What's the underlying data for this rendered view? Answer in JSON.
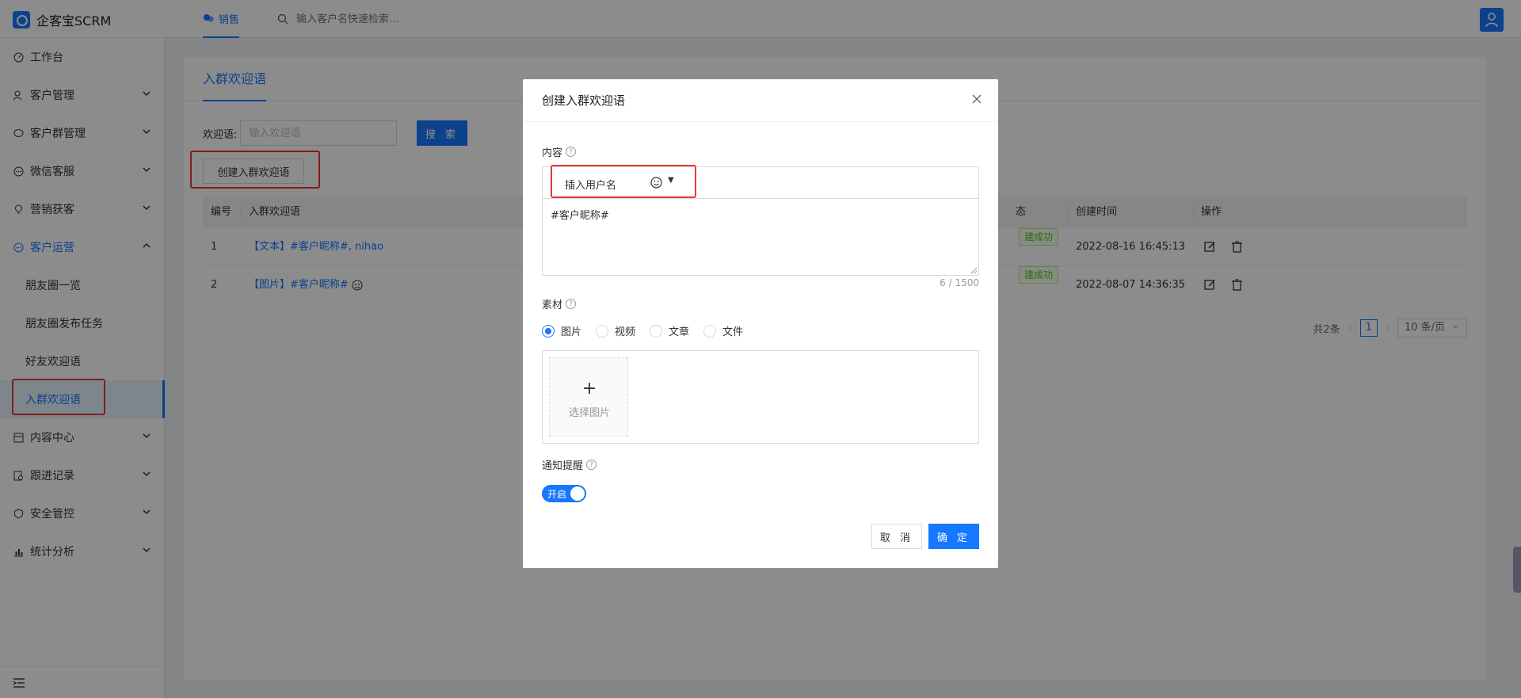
{
  "header": {
    "app_name": "企客宝SCRM",
    "tab_label": "销售",
    "search_placeholder": "输入客户名快速检索..."
  },
  "sidebar": {
    "items": [
      {
        "label": "工作台",
        "icon": "dashboard-icon"
      },
      {
        "label": "客户管理",
        "icon": "user-icon"
      },
      {
        "label": "客户群管理",
        "icon": "chat-group-icon"
      },
      {
        "label": "微信客服",
        "icon": "service-icon"
      },
      {
        "label": "营销获客",
        "icon": "bulb-icon"
      },
      {
        "label": "客户运营",
        "icon": "operation-icon"
      },
      {
        "label": "内容中心",
        "icon": "content-icon"
      },
      {
        "label": "跟进记录",
        "icon": "record-icon"
      },
      {
        "label": "安全管控",
        "icon": "shield-icon"
      },
      {
        "label": "统计分析",
        "icon": "chart-icon"
      }
    ],
    "sub_items": [
      "朋友圈一览",
      "朋友圈发布任务",
      "好友欢迎语",
      "入群欢迎语"
    ]
  },
  "main": {
    "tab": "入群欢迎语",
    "filter_label": "欢迎语:",
    "filter_placeholder": "输入欢迎语",
    "search_button": "搜 索",
    "create_button": "创建入群欢迎语",
    "columns": [
      "编号",
      "入群欢迎语",
      "态",
      "创建时间",
      "操作"
    ],
    "rows": [
      {
        "id": "1",
        "content": "【文本】#客户昵称#, nihao",
        "status": "建成功",
        "time": "2022-08-16 16:45:13"
      },
      {
        "id": "2",
        "content": "【图片】#客户昵称#",
        "status": "建成功",
        "time": "2022-08-07 14:36:35"
      }
    ],
    "pager": {
      "total": "共2条",
      "page": "1",
      "size": "10 条/页"
    }
  },
  "modal": {
    "title": "创建入群欢迎语",
    "content_label": "内容",
    "insert_label": "插入用户名",
    "content_text": "#客户昵称#",
    "counter": "6 / 1500",
    "material_label": "素材",
    "material_options": [
      "图片",
      "视频",
      "文章",
      "文件"
    ],
    "selected_option": "图片",
    "upload_label": "选择图片",
    "notify_label": "通知提醒",
    "switch_text": "开启",
    "cancel": "取 消",
    "ok": "确 定"
  },
  "colors": {
    "primary": "#1677ff",
    "highlight": "#e53935",
    "success": "#52c41a"
  }
}
